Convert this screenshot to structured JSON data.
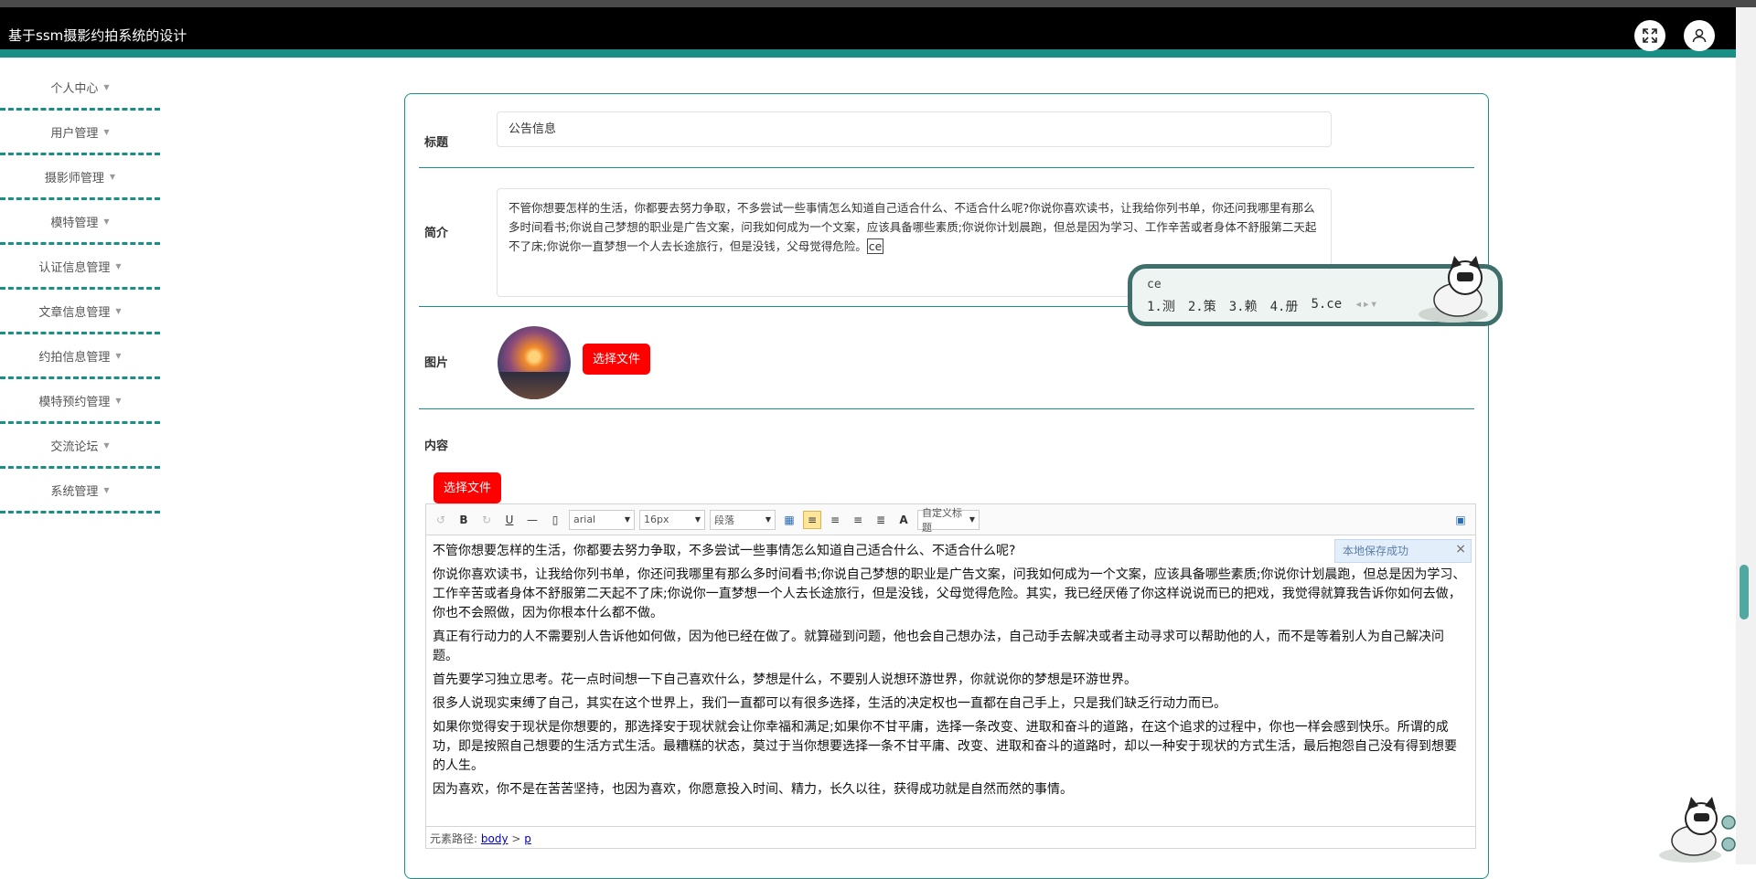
{
  "app": {
    "title": "基于ssm摄影约拍系统的设计"
  },
  "sidebar": {
    "items": [
      {
        "label": "个人中心"
      },
      {
        "label": "用户管理"
      },
      {
        "label": "摄影师管理"
      },
      {
        "label": "模特管理"
      },
      {
        "label": "认证信息管理"
      },
      {
        "label": "文章信息管理"
      },
      {
        "label": "约拍信息管理"
      },
      {
        "label": "模特预约管理"
      },
      {
        "label": "交流论坛"
      },
      {
        "label": "系统管理"
      }
    ]
  },
  "form": {
    "title_label": "标题",
    "title_value": "公告信息",
    "intro_label": "简介",
    "intro_value": "不管你想要怎样的生活，你都要去努力争取，不多尝试一些事情怎么知道自己适合什么、不适合什么呢?你说你喜欢读书，让我给你列书单，你还问我哪里有那么多时间看书;你说自己梦想的职业是广告文案，问我如何成为一个文案，应该具备哪些素质;你说你计划晨跑，但总是因为学习、工作辛苦或者身体不舒服第二天起不了床;你说你一直梦想一个人去长途旅行，但是没钱，父母觉得危险。",
    "intro_typing": "ce",
    "image_label": "图片",
    "choose_file": "选择文件",
    "content_label": "内容",
    "content_choose_file": "选择文件"
  },
  "editor": {
    "font_family": "arial",
    "font_size": "16px",
    "paragraph": "段落",
    "custom_title": "自定义标题",
    "save_notice": "本地保存成功",
    "footer_prefix": "元素路径:",
    "path_body": "body",
    "path_sep": " > ",
    "path_p": "p",
    "paragraphs": [
      "不管你想要怎样的生活，你都要去努力争取，不多尝试一些事情怎么知道自己适合什么、不适合什么呢?",
      "你说你喜欢读书，让我给你列书单，你还问我哪里有那么多时间看书;你说自己梦想的职业是广告文案，问我如何成为一个文案，应该具备哪些素质;你说你计划晨跑，但总是因为学习、工作辛苦或者身体不舒服第二天起不了床;你说你一直梦想一个人去长途旅行，但是没钱，父母觉得危险。其实，我已经厌倦了你这样说说而已的把戏，我觉得就算我告诉你如何去做，你也不会照做，因为你根本什么都不做。",
      "真正有行动力的人不需要别人告诉他如何做，因为他已经在做了。就算碰到问题，他也会自己想办法，自己动手去解决或者主动寻求可以帮助他的人，而不是等着别人为自己解决问题。",
      "首先要学习独立思考。花一点时间想一下自己喜欢什么，梦想是什么，不要别人说想环游世界，你就说你的梦想是环游世界。",
      "很多人说现实束缚了自己，其实在这个世界上，我们一直都可以有很多选择，生活的决定权也一直都在自己手上，只是我们缺乏行动力而已。",
      "如果你觉得安于现状是你想要的，那选择安于现状就会让你幸福和满足;如果你不甘平庸，选择一条改变、进取和奋斗的道路，在这个追求的过程中，你也一样会感到快乐。所谓的成功，即是按照自己想要的生活方式生活。最糟糕的状态，莫过于当你想要选择一条不甘平庸、改变、进取和奋斗的道路时，却以一种安于现状的方式生活，最后抱怨自己没有得到想要的人生。",
      "因为喜欢，你不是在苦苦坚持，也因为喜欢，你愿意投入时间、精力，长久以往，获得成功就是自然而然的事情。"
    ]
  },
  "ime": {
    "input": "ce",
    "candidates": [
      "1.测",
      "2.策",
      "3.赖",
      "4.册",
      "5.ce"
    ]
  },
  "colors": {
    "accent": "#1a8f85",
    "header_bg": "#000000",
    "button_red": "#ff0000"
  },
  "icons": {
    "fullscreen": "fullscreen-icon",
    "user": "user-icon"
  }
}
